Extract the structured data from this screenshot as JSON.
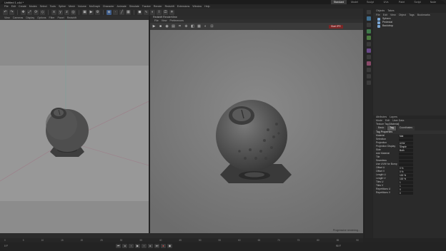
{
  "window": {
    "title": "Untitled 1.c4d *"
  },
  "layouts": [
    "Standard",
    "Model",
    "Sculpt",
    "UVs",
    "Paint",
    "Script",
    "Node"
  ],
  "menubar": [
    "File",
    "Edit",
    "Create",
    "Modes",
    "Select",
    "Tools",
    "Spline",
    "Mesh",
    "Volume",
    "MoGraph",
    "Character",
    "Animate",
    "Simulate",
    "Tracker",
    "Render",
    "Redshift",
    "Extensions",
    "Window",
    "Help"
  ],
  "left_viewport": {
    "menu": [
      "View",
      "Cameras",
      "Display",
      "Options",
      "Filter",
      "Panel",
      "Redshift"
    ]
  },
  "right_viewport": {
    "header": "Redshift RenderView",
    "menu": [
      "File",
      "View",
      "Preferences"
    ],
    "render_button": "Start IPR",
    "status": "Progressive rendering..."
  },
  "objects_panel": {
    "tabs": [
      "Objects",
      "Takes"
    ],
    "menu": [
      "File",
      "Edit",
      "View",
      "Object",
      "Tags",
      "Bookmarks"
    ],
    "rows": [
      "Sphere",
      "Pedestal",
      "Backdrop"
    ]
  },
  "attributes": {
    "tabs": [
      "Attributes",
      "Layers"
    ],
    "menu": [
      "Mode",
      "Edit",
      "User Data"
    ],
    "title": "Texture Tag [Material]",
    "subtabs": [
      "Basic",
      "Tag",
      "Coordinates"
    ],
    "section": "Tag Properties",
    "fields": [
      {
        "label": "Material",
        "value": "Mat"
      },
      {
        "label": "Selection",
        "value": ""
      },
      {
        "label": "Projection",
        "value": "UVW Mapping"
      },
      {
        "label": "Projection Display",
        "value": "Simple"
      },
      {
        "label": "Side",
        "value": "Both"
      },
      {
        "label": "Add Material",
        "value": ""
      },
      {
        "label": "Tile",
        "value": ""
      },
      {
        "label": "Seamless",
        "value": ""
      },
      {
        "label": "Use UVW for Bump",
        "value": ""
      },
      {
        "label": "Offset U",
        "value": "0 %"
      },
      {
        "label": "Offset V",
        "value": "0 %"
      },
      {
        "label": "Length U",
        "value": "100 %"
      },
      {
        "label": "Length V",
        "value": "100 %"
      },
      {
        "label": "Tiles U",
        "value": "1"
      },
      {
        "label": "Tiles V",
        "value": "1"
      },
      {
        "label": "Repetitions U",
        "value": "0"
      },
      {
        "label": "Repetitions V",
        "value": "0"
      }
    ]
  },
  "timeline": {
    "ticks": [
      "0",
      "5",
      "10",
      "15",
      "20",
      "25",
      "30",
      "35",
      "40",
      "45",
      "50",
      "55",
      "60",
      "65",
      "70",
      "75",
      "80",
      "85",
      "90"
    ],
    "current_frame": "0 F",
    "end_frame": "90 F"
  }
}
